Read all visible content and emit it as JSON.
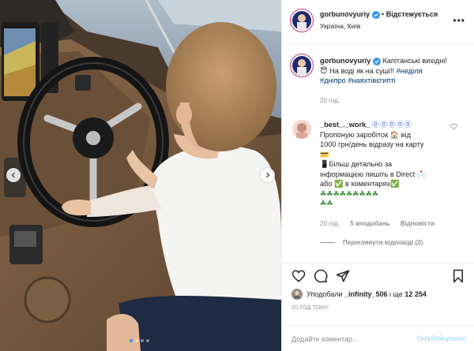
{
  "post": {
    "author": {
      "username": "gorbunovyuriy",
      "verified": true,
      "follow_label": "Відстежується",
      "separator": "•",
      "location": "Україна, Київ"
    },
    "caption": {
      "username": "gorbunovyuriy",
      "text_1": "Капітанські вихідні!",
      "text_2": "На воді як на суші!!",
      "hashtags": [
        "#неділя",
        "#дніпро",
        "#наяхтівєгипті"
      ],
      "time": "20 год."
    },
    "comment": {
      "username": "_best_._work_",
      "username_decor": "⓪⓪⓪⓪⓪",
      "line_1": "Пропоную заробіток 🏠 від",
      "line_2": "1000 грн/день відразу на карту",
      "line_3": "📱Більш детально за",
      "line_4": "інформацією пишіть в Direct 📩",
      "line_5": "або ✅ в коментарях✅",
      "line_6": "☘☘☘☘☘☘☘☘☘",
      "line_7": "☘☘",
      "time": "20 год.",
      "likes_label": "5 вподобань",
      "reply_label": "Відповісти",
      "view_replies_label": "Переглянути відповіді (2)"
    },
    "likes": {
      "prefix": "Уподобали",
      "user": "_infinity_506",
      "middle": "і ще",
      "count": "12 254"
    },
    "date_label": "20 ГОД ТОМУ",
    "add_comment_placeholder": "Додайте коментар...",
    "publish_label": "Опублікувати",
    "carousel": {
      "total_slides": 4,
      "active_slide": 1
    }
  },
  "icons": {
    "verified": "verified-badge-icon",
    "like": "heart-icon",
    "comment": "comment-icon",
    "share": "paper-plane-icon",
    "save": "bookmark-icon",
    "more": "more-options-icon",
    "prev": "chevron-left-icon",
    "next": "chevron-right-icon"
  },
  "colors": {
    "text": "#262626",
    "muted": "#8e8e8e",
    "link": "#00376b",
    "verified": "#3897f0",
    "publish_disabled": "#b2dffc",
    "border": "#efefef"
  }
}
